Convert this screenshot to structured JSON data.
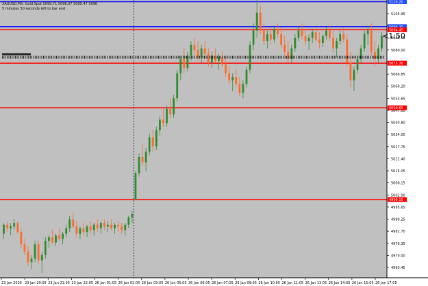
{
  "window": {
    "header_line1": "XAUUSD,M5: Gold Spot  5099.71 5096.07 5095.47 5096",
    "header_line2": "5 minutes 50 seconds left to bar end",
    "countdown": "<1:50"
  },
  "colors": {
    "background": "#c0c0c0",
    "bull": "#2e8b2e",
    "bear": "#ff6a2a",
    "red_line": "#ff0000",
    "blue_line": "#0000ff",
    "tag_red": "#ff0000",
    "tag_blue": "#1e4dff"
  },
  "chart_data": {
    "type": "candlestick",
    "symbol": "XAUUSD",
    "timeframe": "M5",
    "ylim": [
      4956.0,
      5110.0
    ],
    "y_ticks": [
      "5105.95",
      "5092.95",
      "5086.55",
      "5080.00",
      "5073.55",
      "5066.85",
      "5060.20",
      "5053.65",
      "5047.00",
      "5040.80",
      "5034.00",
      "5027.75",
      "5021.40",
      "5015.05",
      "5008.15",
      "5002.00",
      "4995.65",
      "4989.25",
      "4982.70",
      "4976.35",
      "4970.00",
      "4963.45"
    ],
    "x_labels": [
      "23 Jan 2026",
      "23 Jan 20:05",
      "23 Jan 21:05",
      "23 Jan 22:05",
      "26 Jan 01:05",
      "26 Jan 02:05",
      "26 Jan 03:05",
      "26 Jan 05:05",
      "26 Jan 06:05",
      "26 Jan 07:05",
      "26 Jan 09:05",
      "26 Jan 10:05",
      "26 Jan 11:05",
      "26 Jan 13:05",
      "26 Jan 14:05",
      "26 Jan 15:05",
      "26 Jan 17:05"
    ],
    "hlines": [
      {
        "price": 5110.2,
        "color": "blue",
        "label": "5110.20"
      },
      {
        "price": 5096.2,
        "color": "blue",
        "label": "5096.20"
      },
      {
        "price": 5094.45,
        "color": "red",
        "label": "5094.45"
      },
      {
        "price": 5075.7,
        "color": "red",
        "label": "5075.70"
      },
      {
        "price": 5050.65,
        "color": "red",
        "label": "5050.65"
      },
      {
        "price": 4999.15,
        "color": "red",
        "label": "4999.15"
      }
    ],
    "session_break_index": 38,
    "candles": [
      [
        4980,
        4986,
        4977,
        4985
      ],
      [
        4985,
        4987,
        4981,
        4983
      ],
      [
        4983,
        4986,
        4979,
        4984
      ],
      [
        4984,
        4988,
        4982,
        4986
      ],
      [
        4986,
        4987,
        4980,
        4981
      ],
      [
        4981,
        4983,
        4972,
        4974
      ],
      [
        4974,
        4977,
        4968,
        4970
      ],
      [
        4970,
        4973,
        4962,
        4964
      ],
      [
        4964,
        4968,
        4960,
        4966
      ],
      [
        4966,
        4976,
        4964,
        4974
      ],
      [
        4974,
        4976,
        4963,
        4965
      ],
      [
        4965,
        4970,
        4958,
        4968
      ],
      [
        4968,
        4978,
        4966,
        4976
      ],
      [
        4976,
        4979,
        4972,
        4978
      ],
      [
        4978,
        4982,
        4974,
        4975
      ],
      [
        4975,
        4980,
        4973,
        4979
      ],
      [
        4979,
        4983,
        4976,
        4977
      ],
      [
        4977,
        4981,
        4974,
        4980
      ],
      [
        4980,
        4985,
        4978,
        4983
      ],
      [
        4983,
        4990,
        4981,
        4988
      ],
      [
        4988,
        4992,
        4983,
        4984
      ],
      [
        4984,
        4987,
        4978,
        4980
      ],
      [
        4980,
        4984,
        4977,
        4983
      ],
      [
        4983,
        4986,
        4979,
        4981
      ],
      [
        4981,
        4985,
        4978,
        4984
      ],
      [
        4984,
        4987,
        4980,
        4982
      ],
      [
        4982,
        4986,
        4979,
        4985
      ],
      [
        4985,
        4988,
        4981,
        4983
      ],
      [
        4983,
        4987,
        4980,
        4986
      ],
      [
        4986,
        4988,
        4982,
        4984
      ],
      [
        4984,
        4987,
        4981,
        4985
      ],
      [
        4985,
        4988,
        4982,
        4983
      ],
      [
        4983,
        4986,
        4980,
        4985
      ],
      [
        4985,
        4987,
        4981,
        4984
      ],
      [
        4984,
        4986,
        4980,
        4982
      ],
      [
        4982,
        4986,
        4979,
        4985
      ],
      [
        4985,
        4990,
        4983,
        4989
      ],
      [
        4989,
        4993,
        4986,
        4991
      ],
      [
        4999,
        5015,
        4999,
        5014
      ],
      [
        5014,
        5025,
        5012,
        5023
      ],
      [
        5023,
        5030,
        5018,
        5020
      ],
      [
        5020,
        5028,
        5015,
        5026
      ],
      [
        5026,
        5036,
        5024,
        5034
      ],
      [
        5034,
        5038,
        5026,
        5029
      ],
      [
        5029,
        5040,
        5027,
        5038
      ],
      [
        5038,
        5046,
        5035,
        5044
      ],
      [
        5044,
        5050,
        5040,
        5042
      ],
      [
        5042,
        5052,
        5040,
        5050
      ],
      [
        5050,
        5056,
        5045,
        5047
      ],
      [
        5047,
        5058,
        5045,
        5056
      ],
      [
        5056,
        5072,
        5054,
        5070
      ],
      [
        5070,
        5080,
        5066,
        5078
      ],
      [
        5078,
        5084,
        5070,
        5073
      ],
      [
        5073,
        5082,
        5071,
        5080
      ],
      [
        5080,
        5088,
        5077,
        5086
      ],
      [
        5086,
        5090,
        5080,
        5083
      ],
      [
        5083,
        5088,
        5077,
        5079
      ],
      [
        5079,
        5086,
        5076,
        5084
      ],
      [
        5084,
        5088,
        5078,
        5081
      ],
      [
        5081,
        5084,
        5074,
        5076
      ],
      [
        5076,
        5082,
        5073,
        5080
      ],
      [
        5080,
        5084,
        5076,
        5077
      ],
      [
        5077,
        5081,
        5072,
        5079
      ],
      [
        5079,
        5082,
        5074,
        5075
      ],
      [
        5075,
        5078,
        5068,
        5070
      ],
      [
        5070,
        5074,
        5064,
        5066
      ],
      [
        5066,
        5070,
        5060,
        5068
      ],
      [
        5068,
        5072,
        5062,
        5064
      ],
      [
        5064,
        5068,
        5057,
        5059
      ],
      [
        5059,
        5066,
        5056,
        5064
      ],
      [
        5064,
        5074,
        5062,
        5072
      ],
      [
        5072,
        5088,
        5070,
        5086
      ],
      [
        5086,
        5098,
        5083,
        5094
      ],
      [
        5094,
        5112,
        5090,
        5104
      ],
      [
        5104,
        5108,
        5092,
        5094
      ],
      [
        5094,
        5098,
        5086,
        5088
      ],
      [
        5088,
        5094,
        5084,
        5092
      ],
      [
        5092,
        5096,
        5086,
        5089
      ],
      [
        5089,
        5096,
        5087,
        5095
      ],
      [
        5095,
        5098,
        5090,
        5092
      ],
      [
        5092,
        5096,
        5084,
        5086
      ],
      [
        5086,
        5091,
        5080,
        5082
      ],
      [
        5082,
        5088,
        5076,
        5078
      ],
      [
        5078,
        5086,
        5076,
        5084
      ],
      [
        5084,
        5092,
        5082,
        5090
      ],
      [
        5090,
        5096,
        5088,
        5094
      ],
      [
        5094,
        5098,
        5089,
        5091
      ],
      [
        5091,
        5095,
        5086,
        5088
      ],
      [
        5088,
        5092,
        5083,
        5090
      ],
      [
        5090,
        5095,
        5087,
        5093
      ],
      [
        5093,
        5096,
        5088,
        5089
      ],
      [
        5089,
        5093,
        5084,
        5087
      ],
      [
        5087,
        5092,
        5085,
        5091
      ],
      [
        5091,
        5096,
        5089,
        5094
      ],
      [
        5094,
        5097,
        5088,
        5090
      ],
      [
        5090,
        5094,
        5082,
        5084
      ],
      [
        5084,
        5090,
        5079,
        5088
      ],
      [
        5088,
        5094,
        5086,
        5092
      ],
      [
        5092,
        5096,
        5087,
        5089
      ],
      [
        5089,
        5092,
        5074,
        5076
      ],
      [
        5076,
        5082,
        5062,
        5066
      ],
      [
        5066,
        5074,
        5060,
        5072
      ],
      [
        5072,
        5080,
        5070,
        5078
      ],
      [
        5078,
        5086,
        5076,
        5084
      ],
      [
        5084,
        5094,
        5082,
        5092
      ],
      [
        5092,
        5097,
        5086,
        5094
      ],
      [
        5094,
        5098,
        5080,
        5082
      ],
      [
        5082,
        5088,
        5074,
        5078
      ],
      [
        5078,
        5086,
        5076,
        5084
      ],
      [
        5084,
        5093,
        5082,
        5091
      ]
    ]
  }
}
